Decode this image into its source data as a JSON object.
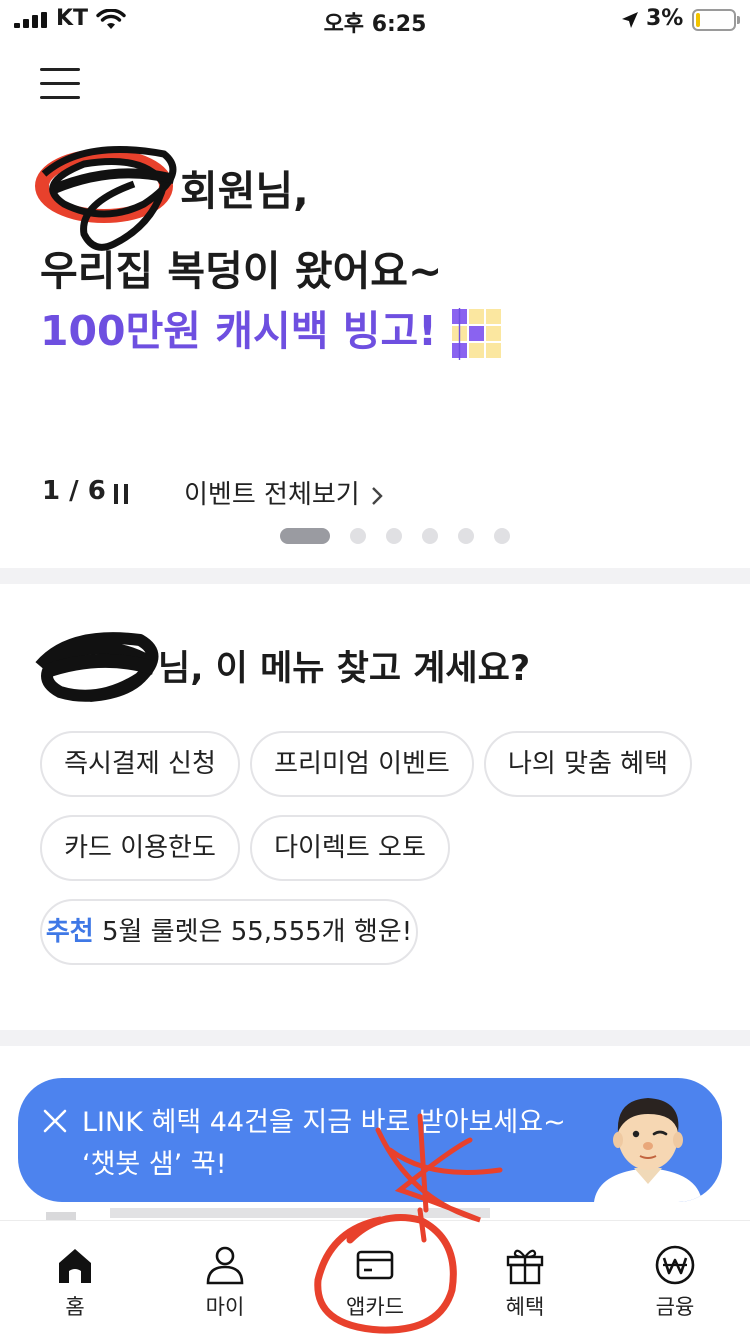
{
  "status_bar": {
    "carrier": "KT",
    "time": "오후 6:25",
    "battery": "3%"
  },
  "hero": {
    "greeting_suffix": "회원님,",
    "headline": "우리집 복덩이 왔어요~",
    "promo": "100만원 캐시백 빙고!",
    "pager": "1 / 6",
    "all_events_link": "이벤트 전체보기"
  },
  "carousel": {
    "total": 6,
    "current": 1
  },
  "menu_section": {
    "title": "님, 이 메뉴 찾고 계세요?",
    "chips": [
      "즉시결제 신청",
      "프리미엄 이벤트",
      "나의 맞춤 혜택",
      "카드 이용한도",
      "다이렉트 오토"
    ],
    "recommend": {
      "tag": "추천",
      "text": "5월 룰렛은 55,555개 행운!"
    }
  },
  "chatbot": {
    "line1": "LINK 혜택 44건을 지금 바로 받아보세요~",
    "line2": "‘챗봇 샘’ 꾹!"
  },
  "tabbar": {
    "items": [
      {
        "label": "홈",
        "icon": "home-icon"
      },
      {
        "label": "마이",
        "icon": "person-icon"
      },
      {
        "label": "앱카드",
        "icon": "card-icon"
      },
      {
        "label": "혜택",
        "icon": "gift-icon"
      },
      {
        "label": "금융",
        "icon": "won-icon"
      }
    ]
  },
  "colors": {
    "accent_purple": "#6e4fe0",
    "accent_blue": "#3f78e6",
    "chatbot_bg": "#4d83ee",
    "scribble_red": "#e8412c"
  }
}
